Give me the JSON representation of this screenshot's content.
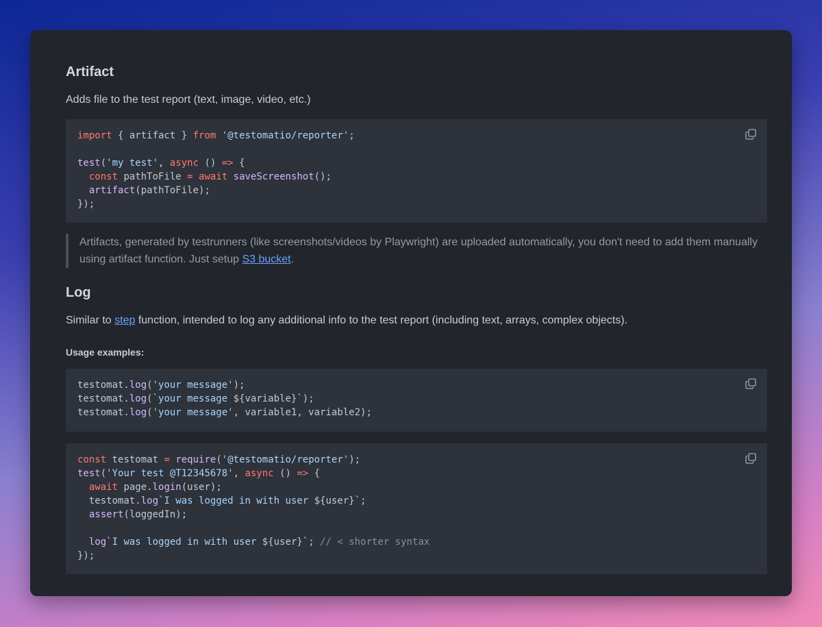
{
  "artifact": {
    "heading": "Artifact",
    "description": "Adds file to the test report (text, image, video, etc.)",
    "code": {
      "l1": {
        "kw": "import",
        "mid": " { artifact } ",
        "kw2": "from",
        "sp": " ",
        "str": "'@testomatio/reporter'",
        "end": ";"
      },
      "l3": {
        "fn": "test",
        "p1": "(",
        "str": "'my test'",
        "p2": ", ",
        "kw": "async",
        "p3": " () ",
        "arrow": "=>",
        "p4": " {"
      },
      "l4": {
        "ind": "  ",
        "kw": "const",
        "mid": " pathToFile ",
        "op": "=",
        "sp": " ",
        "kw2": "await",
        "sp2": " ",
        "fn": "saveScreenshot",
        "end": "();"
      },
      "l5": {
        "ind": "  ",
        "fn": "artifact",
        "end": "(pathToFile);"
      },
      "l6": "});"
    },
    "note_text": "Artifacts, generated by testrunners (like screenshots/videos by Playwright) are uploaded automatically, you don't need to add them manually using artifact function. Just setup ",
    "note_link": "S3 bucket",
    "note_end": "."
  },
  "log": {
    "heading": "Log",
    "desc_before": "Similar to ",
    "desc_link": "step",
    "desc_after": " function, intended to log any additional info to the test report (including text, arrays, complex objects).",
    "usage_label": "Usage examples:",
    "code1": {
      "l1": {
        "obj": "testomat.",
        "fn": "log",
        "p1": "(",
        "str": "'your message'",
        "end": ");"
      },
      "l2": {
        "obj": "testomat.",
        "fn": "log",
        "p1": "(",
        "str": "`your message ",
        "interp": "${variable}",
        "str2": "`",
        "end": ");"
      },
      "l3": {
        "obj": "testomat.",
        "fn": "log",
        "p1": "(",
        "str": "'your message'",
        "end": ", variable1, variable2);"
      }
    },
    "code2": {
      "l1": {
        "kw": "const",
        "mid": " testomat ",
        "op": "=",
        "sp": " ",
        "fn": "require",
        "p1": "(",
        "str": "'@testomatio/reporter'",
        "end": ");"
      },
      "l2": {
        "fn": "test",
        "p1": "(",
        "str": "'Your test @T12345678'",
        "p2": ", ",
        "kw": "async",
        "p3": " () ",
        "arrow": "=>",
        "p4": " {"
      },
      "l3": {
        "ind": "  ",
        "kw": "await",
        "mid": " page.",
        "fn": "login",
        "end": "(user);"
      },
      "l4": {
        "ind": "  ",
        "obj": "testomat.",
        "fn": "log",
        "str": "`I was logged in with user ",
        "interp": "${user}",
        "str2": "`",
        "end": ";"
      },
      "l5": {
        "ind": "  ",
        "fn": "assert",
        "end": "(loggedIn);"
      },
      "l7": {
        "ind": "  ",
        "fn": "log",
        "str": "`I was logged in with user ",
        "interp": "${user}",
        "str2": "`",
        "end": "; ",
        "cm": "// < shorter syntax"
      },
      "l8": "});"
    }
  },
  "icons": {
    "copy": "copy-icon"
  },
  "colors": {
    "keyword": "#ff7a72",
    "string": "#a8d4ff",
    "function": "#d6b8ff",
    "link": "#6aa0ff"
  }
}
